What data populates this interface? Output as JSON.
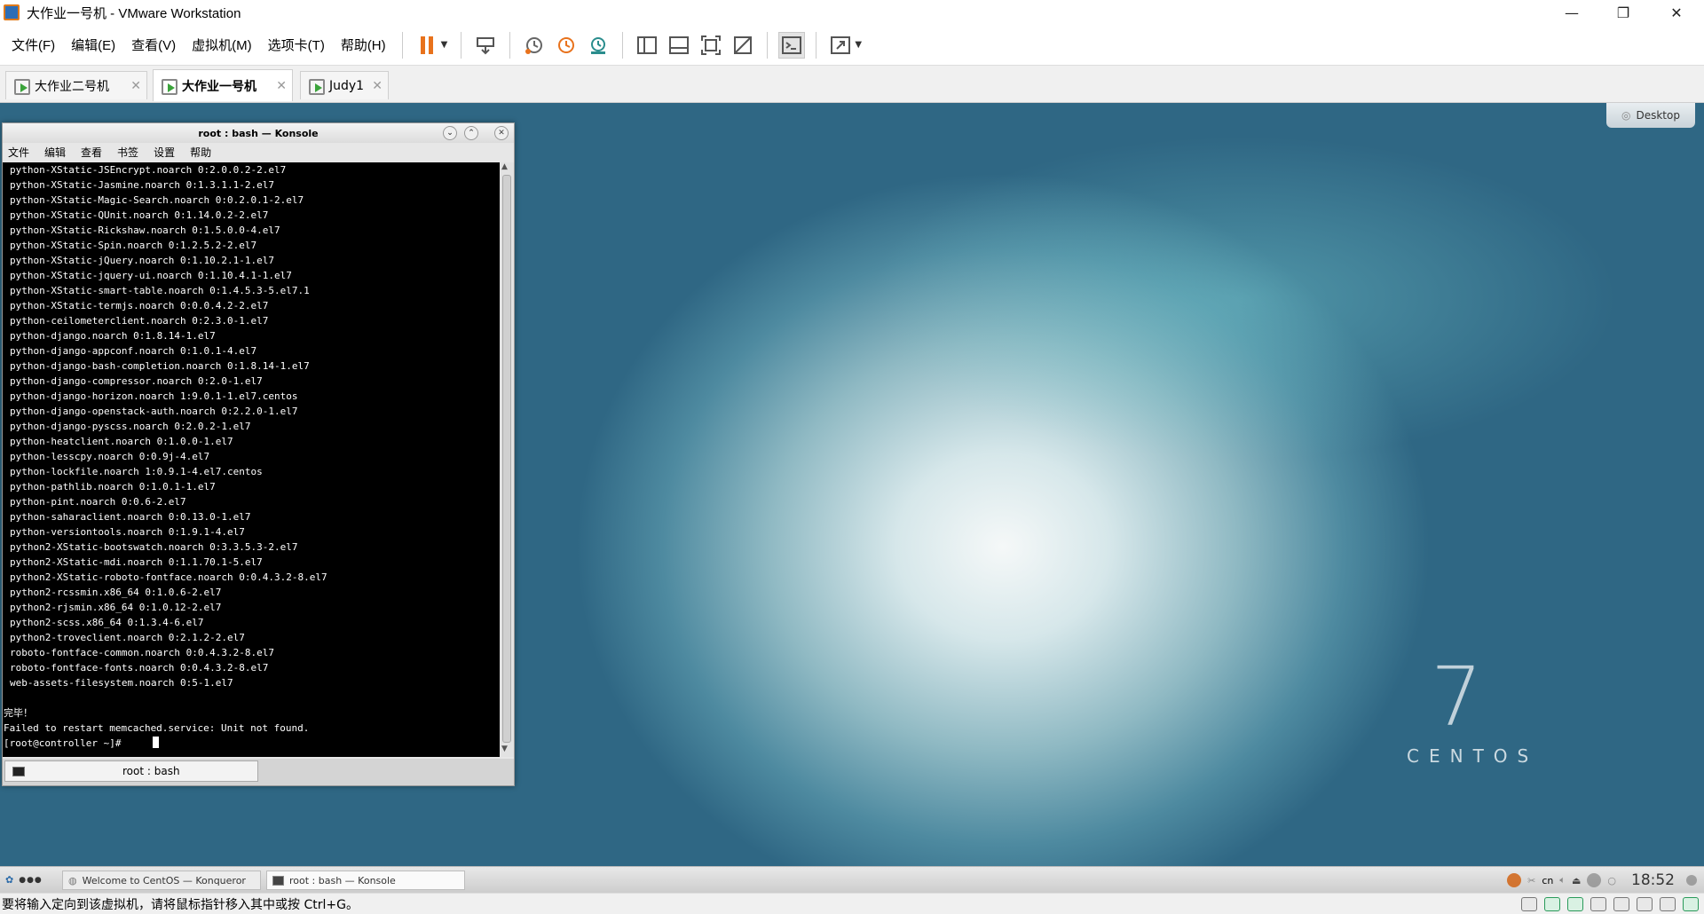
{
  "window": {
    "title": "大作业一号机 - VMware Workstation",
    "controls": {
      "minimize": "—",
      "restore": "❐",
      "close": "✕"
    }
  },
  "menu": [
    "文件(F)",
    "编辑(E)",
    "查看(V)",
    "虚拟机(M)",
    "选项卡(T)",
    "帮助(H)"
  ],
  "toolbar_icons": [
    "pause-icon",
    "send-keys-icon",
    "snapshot-icon",
    "revert-snapshot-icon",
    "snapshot-manager-icon",
    "library-icon",
    "thumbnail-bar-icon",
    "full-screen-icon",
    "unity-icon",
    "console-view-icon",
    "stretch-icon"
  ],
  "tabs": [
    {
      "label": "大作业二号机",
      "active": false
    },
    {
      "label": "大作业一号机",
      "active": true
    },
    {
      "label": "Judy1",
      "active": false
    }
  ],
  "guest": {
    "desktop_button": "Desktop",
    "wallpaper": {
      "seven": "7",
      "word": "CENTOS"
    },
    "konsole": {
      "title": "root : bash — Konsole",
      "menu": [
        "文件",
        "编辑",
        "查看",
        "书签",
        "设置",
        "帮助"
      ],
      "lines": [
        "python-XStatic-JSEncrypt.noarch 0:2.0.0.2-2.el7",
        "python-XStatic-Jasmine.noarch 0:1.3.1.1-2.el7",
        "python-XStatic-Magic-Search.noarch 0:0.2.0.1-2.el7",
        "python-XStatic-QUnit.noarch 0:1.14.0.2-2.el7",
        "python-XStatic-Rickshaw.noarch 0:1.5.0.0-4.el7",
        "python-XStatic-Spin.noarch 0:1.2.5.2-2.el7",
        "python-XStatic-jQuery.noarch 0:1.10.2.1-1.el7",
        "python-XStatic-jquery-ui.noarch 0:1.10.4.1-1.el7",
        "python-XStatic-smart-table.noarch 0:1.4.5.3-5.el7.1",
        "python-XStatic-termjs.noarch 0:0.0.4.2-2.el7",
        "python-ceilometerclient.noarch 0:2.3.0-1.el7",
        "python-django.noarch 0:1.8.14-1.el7",
        "python-django-appconf.noarch 0:1.0.1-4.el7",
        "python-django-bash-completion.noarch 0:1.8.14-1.el7",
        "python-django-compressor.noarch 0:2.0-1.el7",
        "python-django-horizon.noarch 1:9.0.1-1.el7.centos",
        "python-django-openstack-auth.noarch 0:2.2.0-1.el7",
        "python-django-pyscss.noarch 0:2.0.2-1.el7",
        "python-heatclient.noarch 0:1.0.0-1.el7",
        "python-lesscpy.noarch 0:0.9j-4.el7",
        "python-lockfile.noarch 1:0.9.1-4.el7.centos",
        "python-pathlib.noarch 0:1.0.1-1.el7",
        "python-pint.noarch 0:0.6-2.el7",
        "python-saharaclient.noarch 0:0.13.0-1.el7",
        "python-versiontools.noarch 0:1.9.1-4.el7",
        "python2-XStatic-bootswatch.noarch 0:3.3.5.3-2.el7",
        "python2-XStatic-mdi.noarch 0:1.1.70.1-5.el7",
        "python2-XStatic-roboto-fontface.noarch 0:0.4.3.2-8.el7",
        "python2-rcssmin.x86_64 0:1.0.6-2.el7",
        "python2-rjsmin.x86_64 0:1.0.12-2.el7",
        "python2-scss.x86_64 0:1.3.4-6.el7",
        "python2-troveclient.noarch 0:2.1.2-2.el7",
        "roboto-fontface-common.noarch 0:0.4.3.2-8.el7",
        "roboto-fontface-fonts.noarch 0:0.4.3.2-8.el7",
        "web-assets-filesystem.noarch 0:5-1.el7"
      ],
      "done": "完毕！",
      "error": "Failed to restart memcached.service: Unit not found.",
      "prompt": "[root@controller ~]#",
      "tab_label": "root : bash"
    },
    "taskbar": {
      "tasks": [
        "Welcome to CentOS — Konqueror",
        "root : bash — Konsole"
      ],
      "tray_text": "cn",
      "clock": "18:52"
    }
  },
  "statusbar": {
    "hint": "要将输入定向到该虚拟机，请将鼠标指针移入其中或按 Ctrl+G。"
  }
}
